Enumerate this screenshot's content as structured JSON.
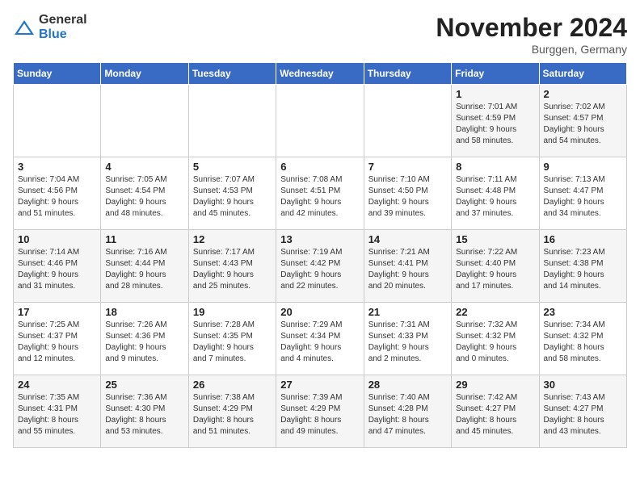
{
  "logo": {
    "general": "General",
    "blue": "Blue"
  },
  "title": "November 2024",
  "subtitle": "Burggen, Germany",
  "days_header": [
    "Sunday",
    "Monday",
    "Tuesday",
    "Wednesday",
    "Thursday",
    "Friday",
    "Saturday"
  ],
  "weeks": [
    [
      {
        "day": "",
        "info": ""
      },
      {
        "day": "",
        "info": ""
      },
      {
        "day": "",
        "info": ""
      },
      {
        "day": "",
        "info": ""
      },
      {
        "day": "",
        "info": ""
      },
      {
        "day": "1",
        "info": "Sunrise: 7:01 AM\nSunset: 4:59 PM\nDaylight: 9 hours\nand 58 minutes."
      },
      {
        "day": "2",
        "info": "Sunrise: 7:02 AM\nSunset: 4:57 PM\nDaylight: 9 hours\nand 54 minutes."
      }
    ],
    [
      {
        "day": "3",
        "info": "Sunrise: 7:04 AM\nSunset: 4:56 PM\nDaylight: 9 hours\nand 51 minutes."
      },
      {
        "day": "4",
        "info": "Sunrise: 7:05 AM\nSunset: 4:54 PM\nDaylight: 9 hours\nand 48 minutes."
      },
      {
        "day": "5",
        "info": "Sunrise: 7:07 AM\nSunset: 4:53 PM\nDaylight: 9 hours\nand 45 minutes."
      },
      {
        "day": "6",
        "info": "Sunrise: 7:08 AM\nSunset: 4:51 PM\nDaylight: 9 hours\nand 42 minutes."
      },
      {
        "day": "7",
        "info": "Sunrise: 7:10 AM\nSunset: 4:50 PM\nDaylight: 9 hours\nand 39 minutes."
      },
      {
        "day": "8",
        "info": "Sunrise: 7:11 AM\nSunset: 4:48 PM\nDaylight: 9 hours\nand 37 minutes."
      },
      {
        "day": "9",
        "info": "Sunrise: 7:13 AM\nSunset: 4:47 PM\nDaylight: 9 hours\nand 34 minutes."
      }
    ],
    [
      {
        "day": "10",
        "info": "Sunrise: 7:14 AM\nSunset: 4:46 PM\nDaylight: 9 hours\nand 31 minutes."
      },
      {
        "day": "11",
        "info": "Sunrise: 7:16 AM\nSunset: 4:44 PM\nDaylight: 9 hours\nand 28 minutes."
      },
      {
        "day": "12",
        "info": "Sunrise: 7:17 AM\nSunset: 4:43 PM\nDaylight: 9 hours\nand 25 minutes."
      },
      {
        "day": "13",
        "info": "Sunrise: 7:19 AM\nSunset: 4:42 PM\nDaylight: 9 hours\nand 22 minutes."
      },
      {
        "day": "14",
        "info": "Sunrise: 7:21 AM\nSunset: 4:41 PM\nDaylight: 9 hours\nand 20 minutes."
      },
      {
        "day": "15",
        "info": "Sunrise: 7:22 AM\nSunset: 4:40 PM\nDaylight: 9 hours\nand 17 minutes."
      },
      {
        "day": "16",
        "info": "Sunrise: 7:23 AM\nSunset: 4:38 PM\nDaylight: 9 hours\nand 14 minutes."
      }
    ],
    [
      {
        "day": "17",
        "info": "Sunrise: 7:25 AM\nSunset: 4:37 PM\nDaylight: 9 hours\nand 12 minutes."
      },
      {
        "day": "18",
        "info": "Sunrise: 7:26 AM\nSunset: 4:36 PM\nDaylight: 9 hours\nand 9 minutes."
      },
      {
        "day": "19",
        "info": "Sunrise: 7:28 AM\nSunset: 4:35 PM\nDaylight: 9 hours\nand 7 minutes."
      },
      {
        "day": "20",
        "info": "Sunrise: 7:29 AM\nSunset: 4:34 PM\nDaylight: 9 hours\nand 4 minutes."
      },
      {
        "day": "21",
        "info": "Sunrise: 7:31 AM\nSunset: 4:33 PM\nDaylight: 9 hours\nand 2 minutes."
      },
      {
        "day": "22",
        "info": "Sunrise: 7:32 AM\nSunset: 4:32 PM\nDaylight: 9 hours\nand 0 minutes."
      },
      {
        "day": "23",
        "info": "Sunrise: 7:34 AM\nSunset: 4:32 PM\nDaylight: 8 hours\nand 58 minutes."
      }
    ],
    [
      {
        "day": "24",
        "info": "Sunrise: 7:35 AM\nSunset: 4:31 PM\nDaylight: 8 hours\nand 55 minutes."
      },
      {
        "day": "25",
        "info": "Sunrise: 7:36 AM\nSunset: 4:30 PM\nDaylight: 8 hours\nand 53 minutes."
      },
      {
        "day": "26",
        "info": "Sunrise: 7:38 AM\nSunset: 4:29 PM\nDaylight: 8 hours\nand 51 minutes."
      },
      {
        "day": "27",
        "info": "Sunrise: 7:39 AM\nSunset: 4:29 PM\nDaylight: 8 hours\nand 49 minutes."
      },
      {
        "day": "28",
        "info": "Sunrise: 7:40 AM\nSunset: 4:28 PM\nDaylight: 8 hours\nand 47 minutes."
      },
      {
        "day": "29",
        "info": "Sunrise: 7:42 AM\nSunset: 4:27 PM\nDaylight: 8 hours\nand 45 minutes."
      },
      {
        "day": "30",
        "info": "Sunrise: 7:43 AM\nSunset: 4:27 PM\nDaylight: 8 hours\nand 43 minutes."
      }
    ]
  ]
}
